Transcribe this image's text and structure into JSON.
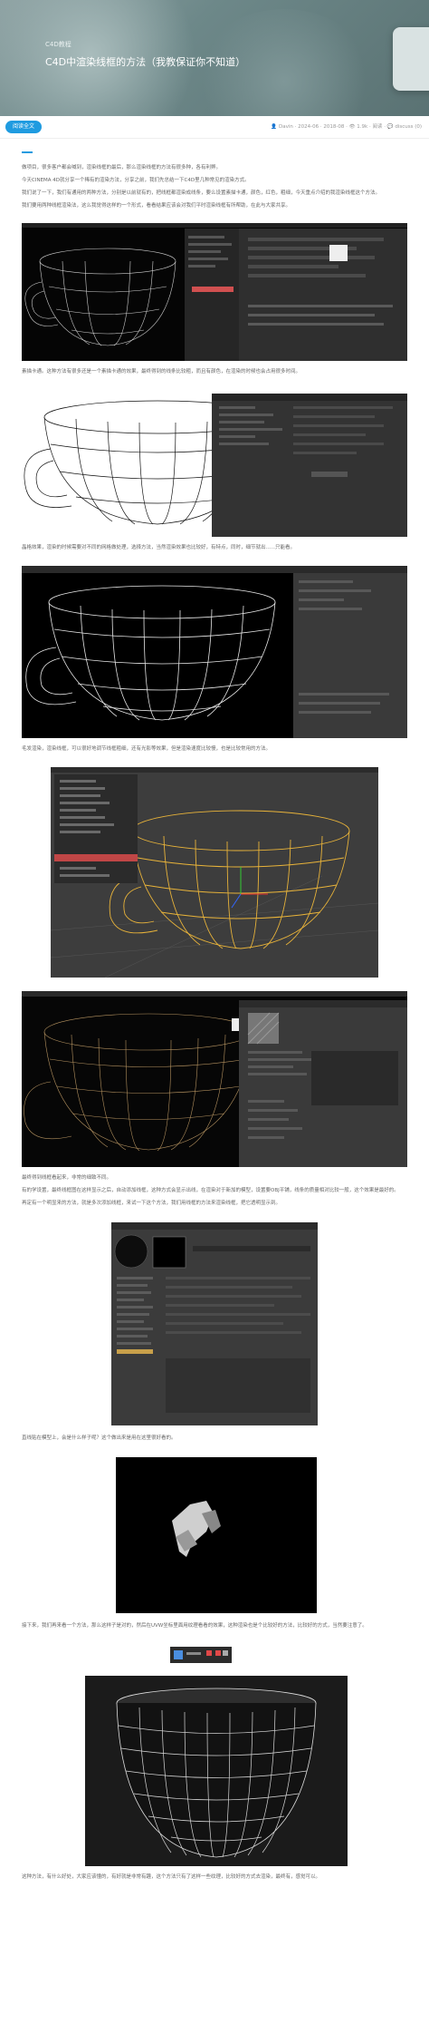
{
  "hero": {
    "category": "C4D教程",
    "title": "C4D中渲染线框的方法（我教保证你不知道）"
  },
  "meta": {
    "badge": "阅读全文",
    "info": "👤 Davin · 2024-06 · 2018-08 · 👁 1.9k · 阅读 · 💬 discuss (0)"
  },
  "paragraphs": {
    "p1": "做项目，很多客户都会喊到，渲染线框的最后，那么渲染线框的方法有很多种，各有利弊。",
    "p2": "今天CINEMA 4D就分享一个稀有的渲染方法，分享之前，我们先总结一下C4D里几种常见的渲染方式。",
    "p3": "我们说了一下，我们有通用的两种方法，分别是以前就有的，把线框都渲染成线条，要么设置素描卡通，颜色，红色，粗细，今天重点介绍的我渲染线框这个方法。",
    "p4": "我们要用两种线框渲染法，这么我觉得这样的一个形式，看看结果应该会对我们平时渲染线框有所帮助，在此与大家共享。",
    "p5": "素描卡通。这种方法有很多还是一个素描卡通的效果，最终得到的线条比较粗，而且有颜色，在渲染的时候也会占用很多时间。",
    "p6": "晶格效果，渲染的时候需要对不同的网格做处理，选择方法，当然渲染效果也比较好，有特点，同时，细节就出......只能看。",
    "p7": "毛发渲染，渲染线框，可以很好地调节线框粗细，还有光影等效果，但是渲染速度比较慢，也是比较常用的方法。",
    "p8": "最终得到线框看起来，非常的细致不同。",
    "p9": "有的学设置，最终线框图在这样显示之后，自动添加线框，这种方式会显示出线，在渲染对于新加的模型，设置要OBJ平铺，线条的质量相对比较一般，这个效果是最好的。",
    "p10": "再定有一个明显来的方法，就是多次添加线框，来试一下这个方法，我们用线框的方法来渲染线框，把它透明显示到。",
    "p11": "直线贴在模型上，会是什么样子呢？这个做出来是用在这里很好看的。",
    "p12": "接下来，我们再来看一个方法，那么这样子是对的，然后在UVW坐标里面用纹理看看的效果，这种渲染也是个比较好的方法，比较好的方式，当然要注意了。",
    "p13": "这种方法，有什么好处，大家应该懂的，有好就是非常有趣，这个方法只有了这样一些纹理，比较好的方式去渲染，最终有，感觉可以。"
  },
  "screenshots": [
    {
      "id": "wireframe-render-ui"
    },
    {
      "id": "cup-on-white-ui"
    },
    {
      "id": "cup-on-black-ui"
    },
    {
      "id": "viewport-menu-ui"
    },
    {
      "id": "glow-wire-ui"
    },
    {
      "id": "material-editor-ui"
    },
    {
      "id": "uv-patch"
    },
    {
      "id": "small-toolbar"
    },
    {
      "id": "cup-grid-render"
    }
  ],
  "colors": {
    "accent": "#1f9be0",
    "wire_yellow": "#e8b33a",
    "viewport_bg": "#3d3d3d"
  }
}
